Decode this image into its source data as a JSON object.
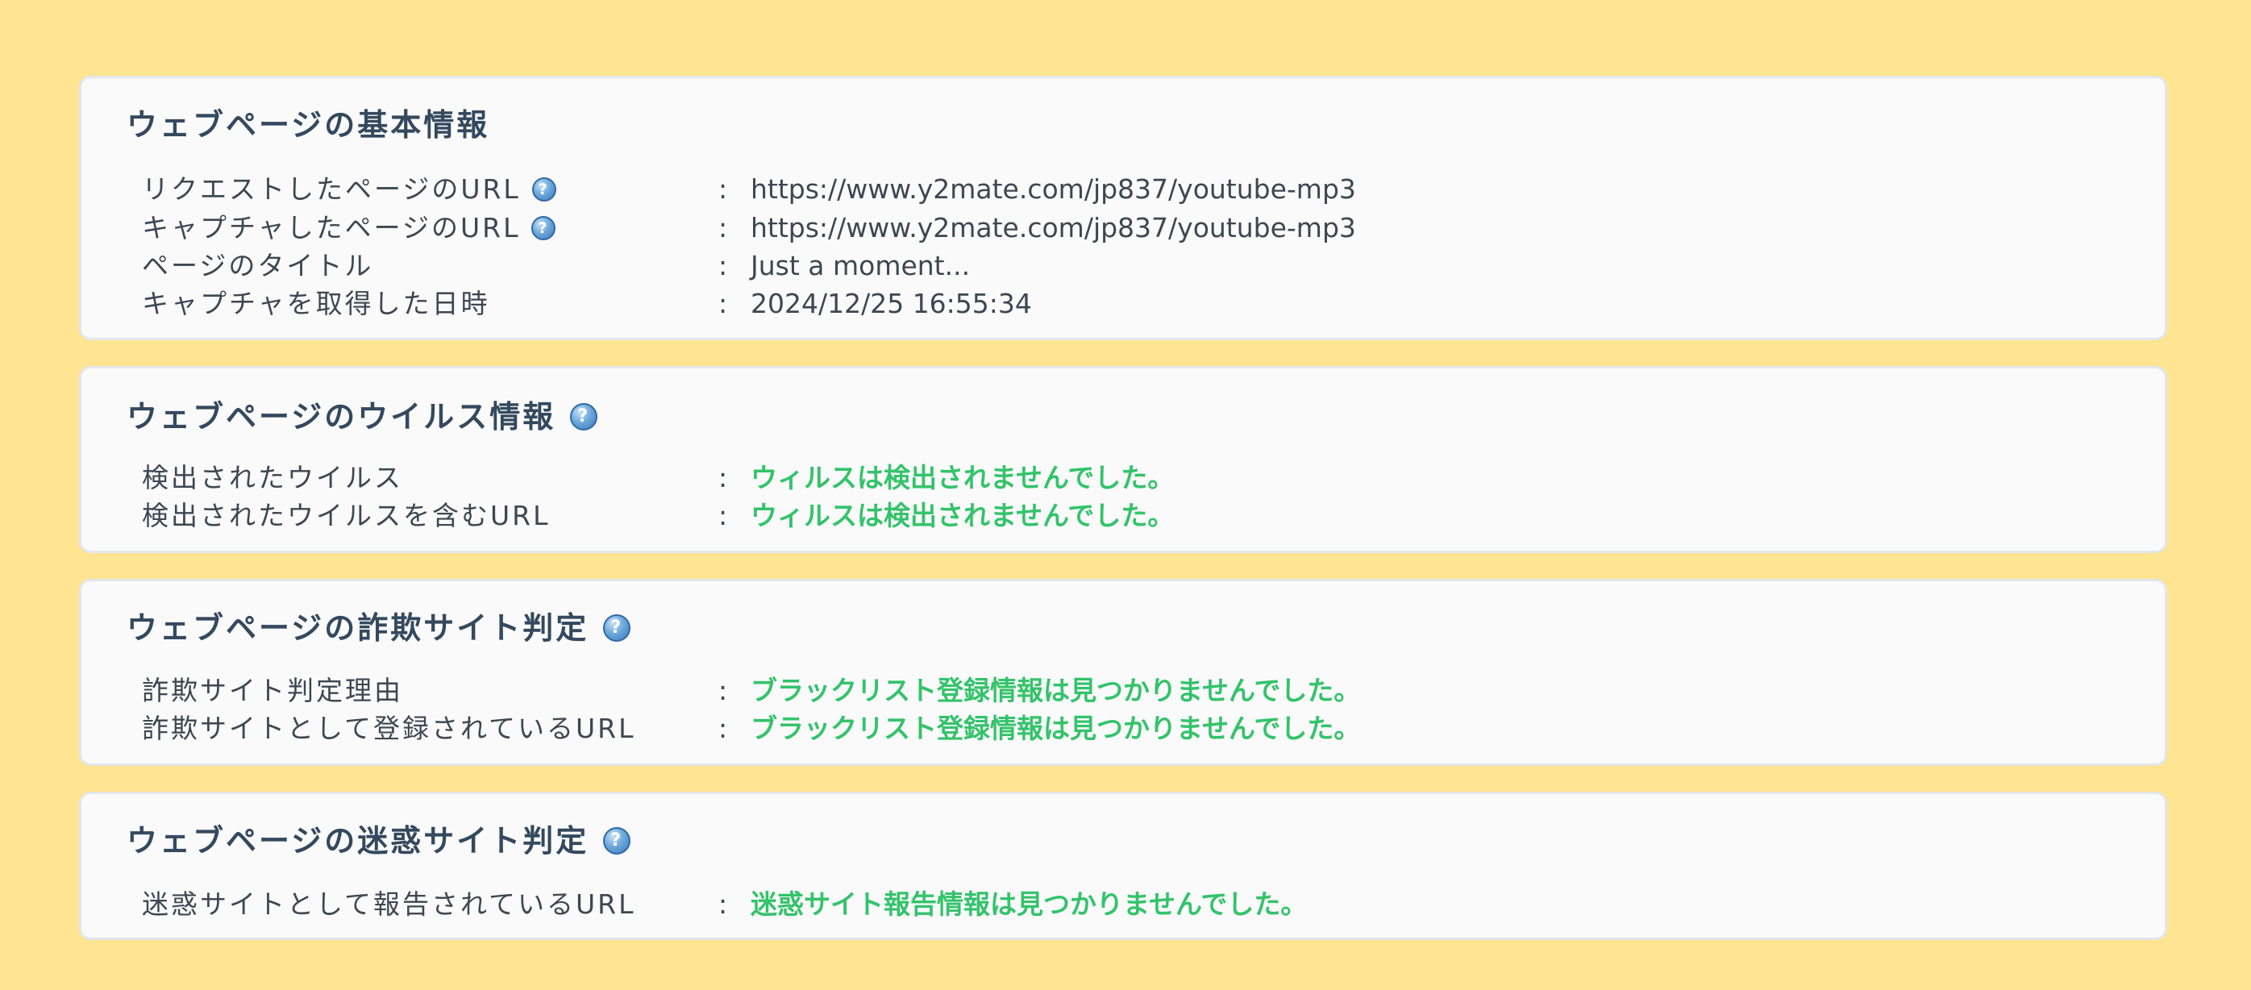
{
  "sections": [
    {
      "title": "ウェブページの基本情報",
      "help_icon": "help-icon",
      "rows": [
        {
          "label": "リクエストしたページのURL",
          "value": "https://www.y2mate.com/jp837/youtube-mp3"
        },
        {
          "label": "キャプチャしたページのURL",
          "value": "https://www.y2mate.com/jp837/youtube-mp3"
        },
        {
          "label": "ページのタイトル",
          "value": "Just a moment..."
        },
        {
          "label": "キャプチャを取得した日時",
          "value": "2024/12/25 16:55:34"
        }
      ]
    },
    {
      "title": "ウェブページのウイルス情報",
      "help_icon": "help-icon",
      "rows": [
        {
          "label": "検出されたウイルス",
          "value": "ウィルスは検出されませんでした。"
        },
        {
          "label": "検出されたウイルスを含むURL",
          "value": "ウィルスは検出されませんでした。"
        }
      ]
    },
    {
      "title": "ウェブページの詐欺サイト判定",
      "help_icon": "help-icon",
      "rows": [
        {
          "label": "詐欺サイト判定理由",
          "value": "ブラックリスト登録情報は見つかりませんでした。"
        },
        {
          "label": "詐欺サイトとして登録されているURL",
          "value": "ブラックリスト登録情報は見つかりませんでした。"
        }
      ]
    },
    {
      "title": "ウェブページの迷惑サイト判定",
      "help_icon": "help-icon",
      "rows": [
        {
          "label": "迷惑サイトとして報告されているURL",
          "value": "迷惑サイト報告情報は見つかりませんでした。"
        }
      ]
    }
  ],
  "separator": ":",
  "help_glyph": "?",
  "colors": {
    "background": "#ffe491",
    "card": "#fafafa",
    "title": "#34495e",
    "ok_status": "#34c36b"
  }
}
